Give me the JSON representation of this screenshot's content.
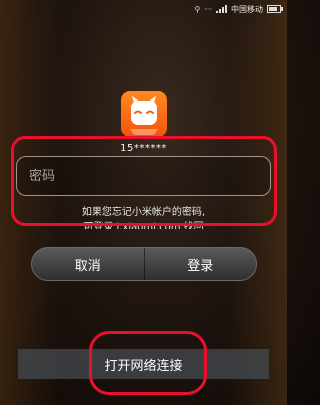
{
  "status_bar": {
    "carrier": "中国移动",
    "icons": [
      "usb-icon",
      "notification-dots-icon",
      "signal-icon",
      "battery-icon"
    ]
  },
  "app": {
    "icon": "mi-bunny-icon",
    "brand_color": "#ff6a14"
  },
  "login": {
    "account_id": "15******",
    "password_placeholder": "密码",
    "hint_line1": "如果您忘记小米帐户的密码,",
    "hint_line2": "可登录 i.xiaomi.com 找回",
    "cancel_label": "取消",
    "login_label": "登录"
  },
  "network": {
    "open_network_label": "打开网络连接"
  },
  "annotation_color": "#e8102c"
}
